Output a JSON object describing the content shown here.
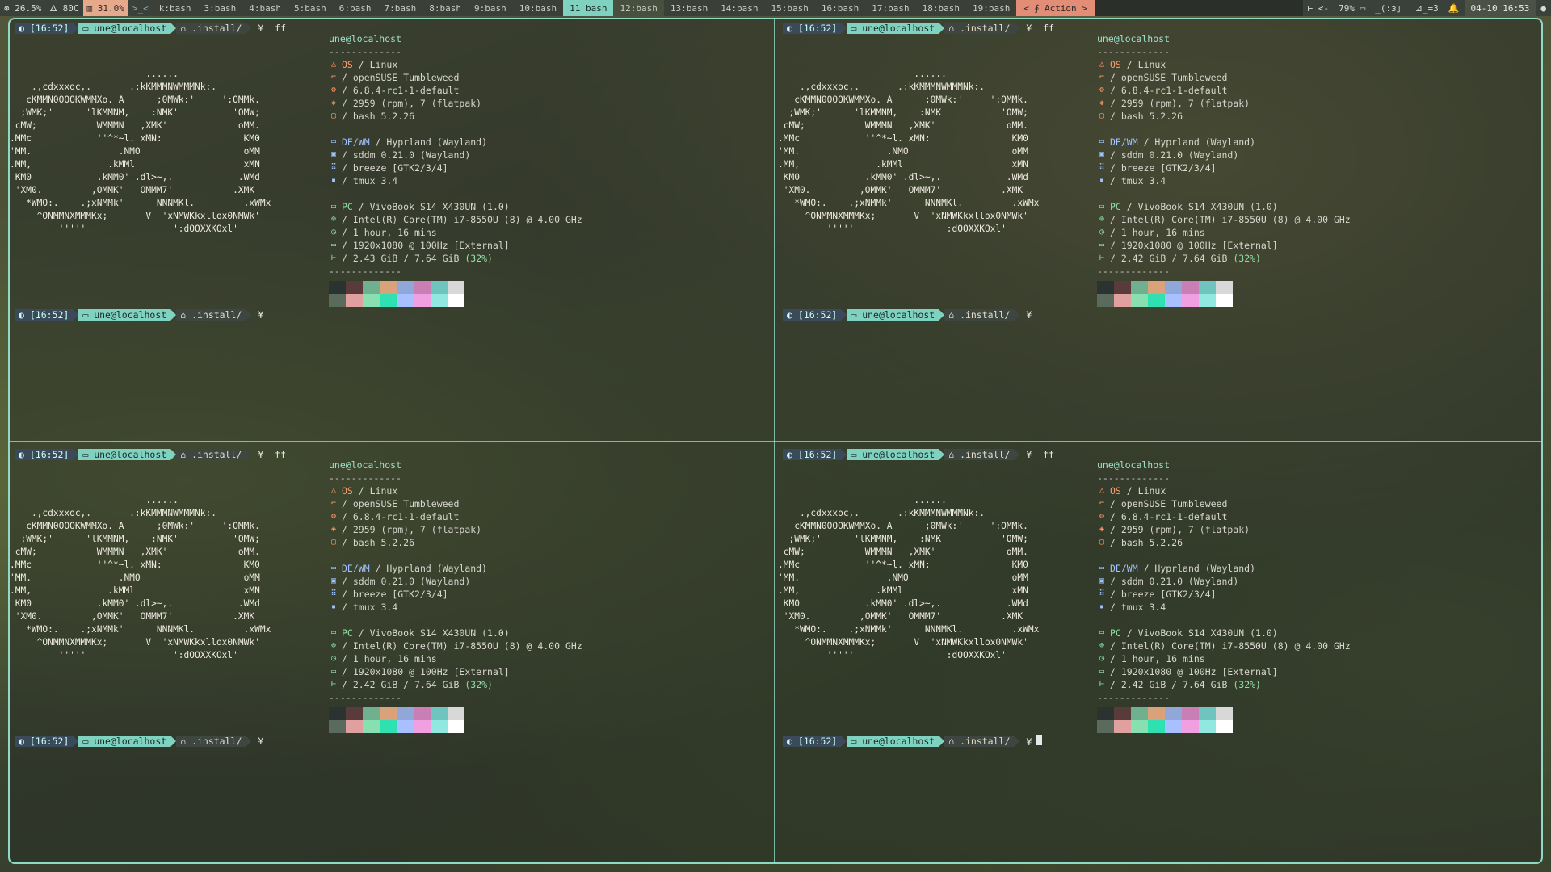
{
  "topbar": {
    "cpu": "26.5%",
    "temp": "80C",
    "mem": "31.0%",
    "prompt_glyph": ">_<",
    "windows": [
      {
        "label": "k:bash",
        "state": ""
      },
      {
        "label": "3:bash",
        "state": ""
      },
      {
        "label": "4:bash",
        "state": ""
      },
      {
        "label": "5:bash",
        "state": ""
      },
      {
        "label": "6:bash",
        "state": ""
      },
      {
        "label": "7:bash",
        "state": ""
      },
      {
        "label": "8:bash",
        "state": ""
      },
      {
        "label": "9:bash",
        "state": ""
      },
      {
        "label": "10:bash",
        "state": ""
      },
      {
        "label": "11 bash",
        "state": "active"
      },
      {
        "label": "12:bash",
        "state": "alt"
      },
      {
        "label": "13:bash",
        "state": ""
      },
      {
        "label": "14:bash",
        "state": ""
      },
      {
        "label": "15:bash",
        "state": ""
      },
      {
        "label": "16:bash",
        "state": ""
      },
      {
        "label": "17:bash",
        "state": ""
      },
      {
        "label": "18:bash",
        "state": ""
      },
      {
        "label": "19:bash",
        "state": ""
      }
    ],
    "action": "< ∮ Action >",
    "right_items": [
      "⊢ <-",
      "79% ▭",
      "_(:з」",
      "⊿_=3",
      "🔔"
    ],
    "datetime": "04-10 16:53",
    "dot": "●"
  },
  "prompt": {
    "time": "[16:52]",
    "user": "une@localhost",
    "path": ".install/",
    "symbol": "¥",
    "command": "ff"
  },
  "logo": [
    "                         ......",
    "    .,cdxxxoc,.       .:kKMMMNWMMMNk:.",
    "   cKMMN0OOOKWMMXo. A      ;0MWk:'     ':OMMk.",
    "  ;WMK;'      'lKMMNM,    :NMK'          'OMW;",
    " cMW;           WMMMN   ,XMK'             oMM.",
    ".MMc            ''^*~l. xMN:               KM0",
    "'MM.                .NMO                   oMM",
    ".MM,              .kMMl                    xMN",
    " KM0            .kMM0' .dl>~,.            .WMd",
    " 'XM0.         ,OMMK'   OMMM7'           .XMK",
    "   *WMO:.    .;xNMMk'      NNNMKl.         .xWMx",
    "     ^ONMMNXMMMKx;       V  'xNMWKkxllox0NMWk'",
    "         '''''                ':dOOXXKOxl'"
  ],
  "panes": [
    {
      "mem_used": "2.43 GiB",
      "idle_prompt": true,
      "cursor": false
    },
    {
      "mem_used": "2.42 GiB",
      "idle_prompt": true,
      "cursor": false
    },
    {
      "mem_used": "2.42 GiB",
      "idle_prompt": true,
      "cursor": false
    },
    {
      "mem_used": "2.42 GiB",
      "idle_prompt": true,
      "cursor": true
    }
  ],
  "info": {
    "host": "une@localhost",
    "separator": "-------------",
    "os_label": "OS",
    "os_value": "/ Linux",
    "distro": "/ openSUSE Tumbleweed",
    "kernel": "/ 6.8.4-rc1-1-default",
    "packages": "/ 2959 (rpm), 7 (flatpak)",
    "shell": "/ bash 5.2.26",
    "de_label": "DE/WM",
    "de_value": "/ Hyprland (Wayland)",
    "lm": "/ sddm 0.21.0 (Wayland)",
    "theme": "/ breeze [GTK2/3/4]",
    "terminal": "/ tmux 3.4",
    "pc_label": "PC",
    "pc_value": "/ VivoBook S14 X430UN (1.0)",
    "cpu": "/ Intel(R) Core(TM) i7-8550U (8) @ 4.00 GHz",
    "uptime": "/ 1 hour, 16 mins",
    "display": "/ 1920x1080 @ 100Hz [External]",
    "mem_total": "7.64 GiB",
    "mem_pct": "(32%)"
  },
  "colors": {
    "accent": "#7fd1c0",
    "swatches_top": [
      "#2b3330",
      "#5a3b3b",
      "#6fb08e",
      "#d9a27a",
      "#8fa8d8",
      "#c97fb6",
      "#6fc4c0",
      "#d8d8d8"
    ],
    "swatches_bottom": [
      "#5a6a5c",
      "#e0a0a0",
      "#88e0b0",
      "#2fe0b0",
      "#a8c0ff",
      "#f0a0e0",
      "#90e8e0",
      "#ffffff"
    ]
  }
}
